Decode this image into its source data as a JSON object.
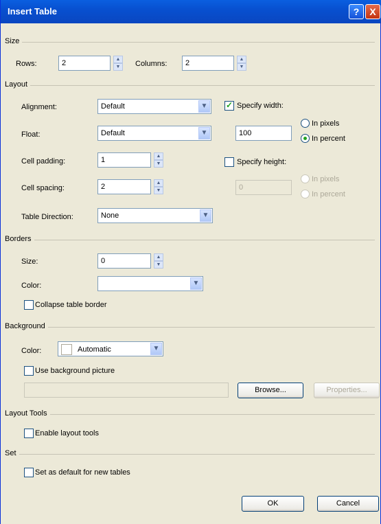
{
  "window": {
    "title": "Insert Table",
    "help": "?",
    "close": "X"
  },
  "size": {
    "header": "Size",
    "rows_label": "Rows:",
    "rows_value": "2",
    "columns_label": "Columns:",
    "columns_value": "2"
  },
  "layout": {
    "header": "Layout",
    "alignment_label": "Alignment:",
    "alignment_value": "Default",
    "float_label": "Float:",
    "float_value": "Default",
    "cell_padding_label": "Cell padding:",
    "cell_padding_value": "1",
    "cell_spacing_label": "Cell spacing:",
    "cell_spacing_value": "2",
    "table_direction_label": "Table Direction:",
    "table_direction_value": "None",
    "specify_width_label": "Specify width:",
    "specify_width_checked": true,
    "width_value": "100",
    "width_in_pixels_label": "In pixels",
    "width_in_percent_label": "In percent",
    "specify_height_label": "Specify height:",
    "specify_height_checked": false,
    "height_value": "0",
    "height_in_pixels_label": "In pixels",
    "height_in_percent_label": "In percent"
  },
  "borders": {
    "header": "Borders",
    "size_label": "Size:",
    "size_value": "0",
    "color_label": "Color:",
    "color_value": "",
    "collapse_label": "Collapse table border"
  },
  "background": {
    "header": "Background",
    "color_label": "Color:",
    "color_value": "Automatic",
    "use_picture_label": "Use background picture",
    "picture_path": "",
    "browse_label": "Browse...",
    "properties_label": "Properties..."
  },
  "layout_tools": {
    "header": "Layout Tools",
    "enable_label": "Enable layout tools"
  },
  "set": {
    "header": "Set",
    "default_label": "Set as default for new tables"
  },
  "footer": {
    "ok_label": "OK",
    "cancel_label": "Cancel"
  },
  "glyphs": {
    "check": "✓",
    "spin_up": "▲",
    "spin_down": "▼",
    "dropdown": "▼"
  }
}
